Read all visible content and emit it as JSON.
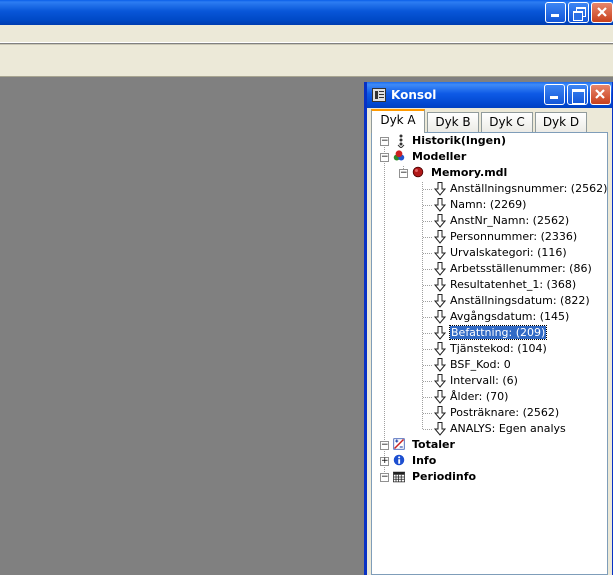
{
  "main_window": {
    "minimize_icon": "minimize-icon",
    "restore_icon": "restore-icon",
    "close_icon": "close-icon"
  },
  "konsol": {
    "title": "Konsol",
    "tabs": [
      {
        "label": "Dyk A",
        "active": true
      },
      {
        "label": "Dyk B",
        "active": false
      },
      {
        "label": "Dyk C",
        "active": false
      },
      {
        "label": "Dyk D",
        "active": false
      }
    ],
    "tree": {
      "historik": "Historik(Ingen)",
      "modeller": "Modeller",
      "model_file": "Memory.mdl",
      "fields": [
        "Anställningsnummer: (2562)",
        "Namn: (2269)",
        "AnstNr_Namn: (2562)",
        "Personnummer: (2336)",
        "Urvalskategori: (116)",
        "Arbetsställenummer: (86)",
        "Resultatenhet_1: (368)",
        "Anställningsdatum: (822)",
        "Avgångsdatum: (145)",
        "Befattning: (209)",
        "Tjänstekod: (104)",
        "BSF_Kod: 0",
        "Intervall: (6)",
        "Ålder: (70)",
        "Posträknare: (2562)",
        "ANALYS: Egen analys"
      ],
      "selected_field": "Befattning: (209)",
      "totaler": "Totaler",
      "info": "Info",
      "periodinfo": "Periodinfo"
    }
  }
}
